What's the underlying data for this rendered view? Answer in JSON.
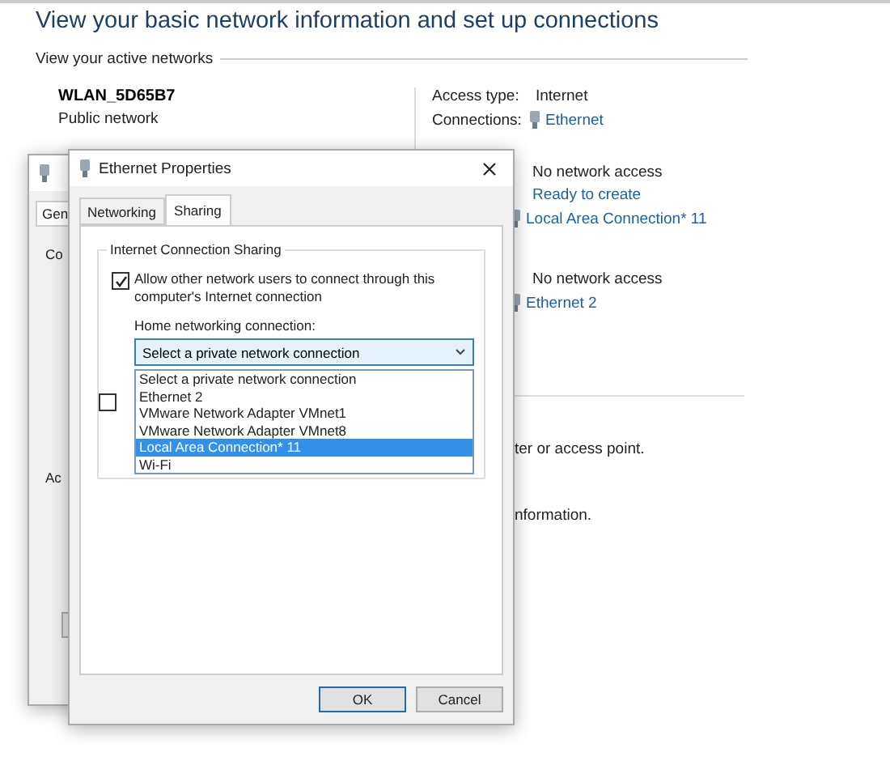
{
  "page": {
    "heading": "View your basic network information and set up connections",
    "section_title": "View your active networks",
    "network": {
      "name": "WLAN_5D65B7",
      "type": "Public network"
    },
    "details": [
      {
        "label": "Access type:",
        "value": "Internet",
        "kind": "text"
      },
      {
        "label": "Connections:",
        "value": "Ethernet",
        "kind": "link"
      }
    ],
    "adapters": [
      {
        "status": "No network access",
        "action": "Ready to create",
        "link": "Local Area Connection* 11"
      },
      {
        "status": "No network access",
        "link": "Ethernet 2"
      }
    ],
    "partial_texts": [
      "ter or access point.",
      "nformation."
    ]
  },
  "back_dialog": {
    "tab": "Gen",
    "labels": [
      "Co",
      "Ac"
    ]
  },
  "dialog": {
    "title": "Ethernet Properties",
    "tabs": [
      {
        "label": "Networking",
        "selected": false
      },
      {
        "label": "Sharing",
        "selected": true
      }
    ],
    "group_title": "Internet Connection Sharing",
    "allow": {
      "label": "Allow other network users to connect through this computer's Internet connection",
      "checked": true
    },
    "home_label": "Home networking connection:",
    "select": {
      "value": "Select a private network connection",
      "expanded": true
    },
    "options": [
      {
        "label": "Select a private network connection",
        "selected": false
      },
      {
        "label": "Ethernet 2",
        "selected": false
      },
      {
        "label": "VMware Network Adapter VMnet1",
        "selected": false
      },
      {
        "label": "VMware Network Adapter VMnet8",
        "selected": false
      },
      {
        "label": "Local Area Connection* 11",
        "selected": true
      },
      {
        "label": "Wi-Fi",
        "selected": false
      }
    ],
    "second_checkbox": {
      "checked": false
    },
    "buttons": [
      {
        "label": "OK",
        "default": true
      },
      {
        "label": "Cancel",
        "default": false
      }
    ]
  }
}
